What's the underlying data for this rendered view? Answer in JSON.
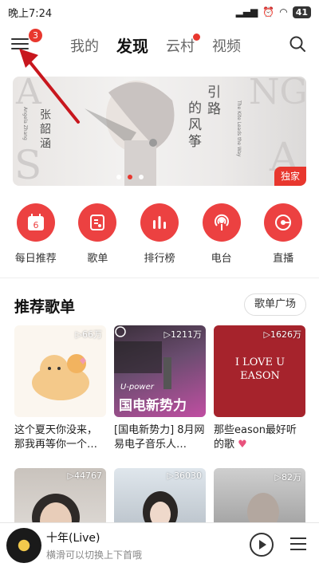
{
  "status_bar": {
    "time": "晚上7:24",
    "battery": "41"
  },
  "header": {
    "menu_badge": "3",
    "tabs": [
      {
        "label": "我的",
        "active": false,
        "dot": false
      },
      {
        "label": "发现",
        "active": true,
        "dot": false
      },
      {
        "label": "云村",
        "active": false,
        "dot": true
      },
      {
        "label": "视频",
        "active": false,
        "dot": false
      }
    ]
  },
  "banner": {
    "text_left": "张韶涵",
    "text_left_en": "Angela Zhang",
    "text_mid": "引路",
    "text_mid2": "的风筝",
    "text_right_en": "The Kite Leads the Way",
    "tag": "独家",
    "accent": "#e8372e"
  },
  "shortcuts": [
    {
      "label": "每日推荐",
      "icon": "calendar-icon",
      "day": "6"
    },
    {
      "label": "歌单",
      "icon": "playlist-icon"
    },
    {
      "label": "排行榜",
      "icon": "chart-icon"
    },
    {
      "label": "电台",
      "icon": "radio-icon"
    },
    {
      "label": "直播",
      "icon": "live-icon"
    }
  ],
  "section": {
    "title": "推荐歌单",
    "button": "歌单广场"
  },
  "playlists": [
    {
      "playcount": "▷66万",
      "title": "这个夏天你没来，那我再等你一个…",
      "heart": ""
    },
    {
      "playcount": "▷1211万",
      "title": "[国电新势力] 8月网易电子音乐人…",
      "heart": "",
      "cover_text": "国电新势力",
      "cover_sub": "U-power"
    },
    {
      "playcount": "▷1626万",
      "title": "那些eason最好听的歌",
      "heart": "♥",
      "cover_text": "I LOVE U EASON"
    },
    {
      "playcount": "▷44767",
      "title": "",
      "heart": ""
    },
    {
      "playcount": "▷36030",
      "title": "",
      "heart": ""
    },
    {
      "playcount": "▷82万",
      "title": "",
      "heart": ""
    }
  ],
  "player": {
    "song": "十年(Live)",
    "hint": "横滑可以切换上下首哦"
  },
  "colors": {
    "brand": "#ec4141",
    "text": "#222222"
  }
}
